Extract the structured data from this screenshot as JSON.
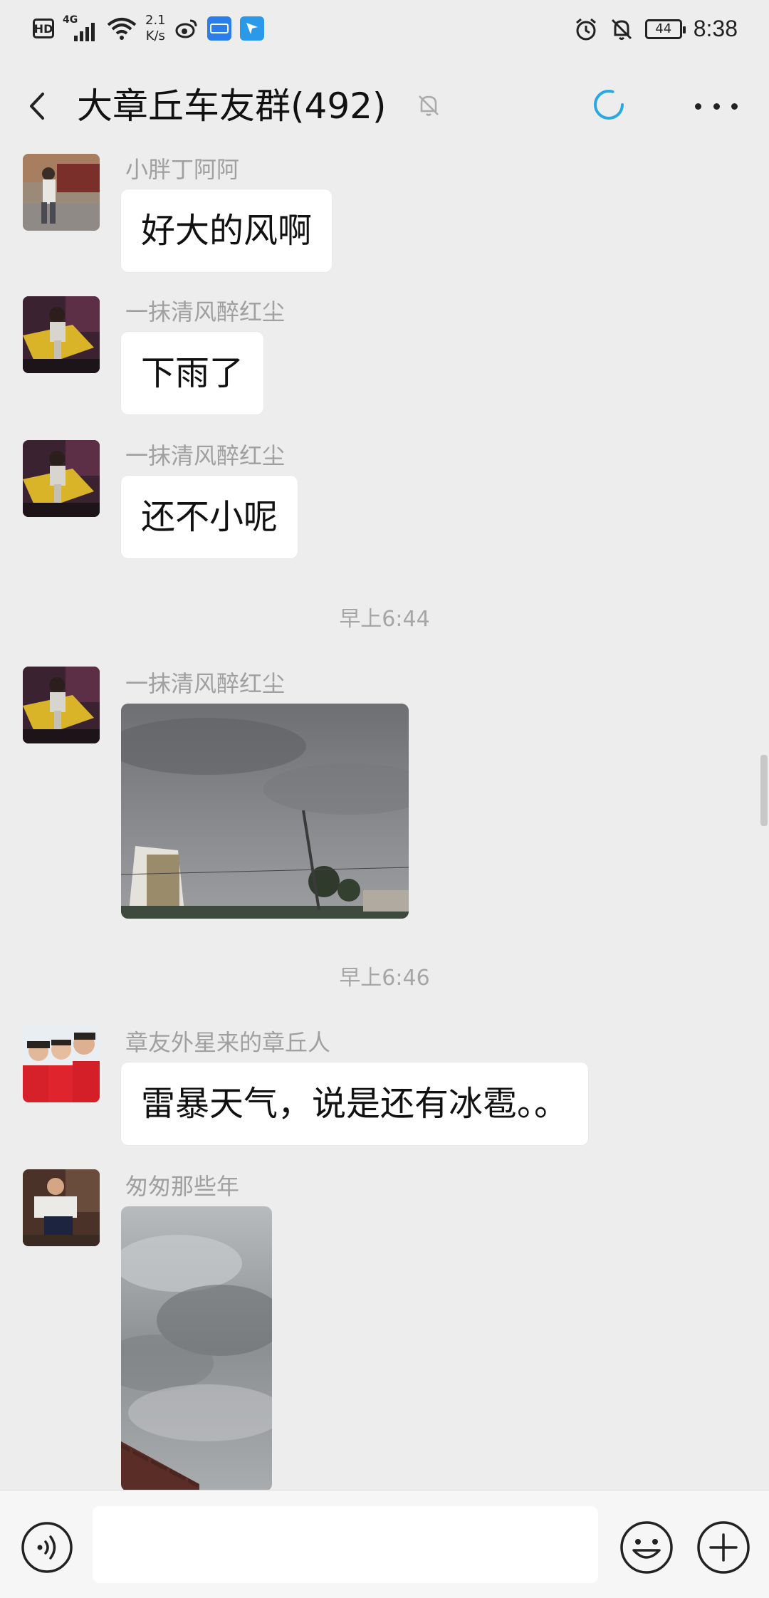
{
  "status_bar": {
    "hd_label": "HD",
    "network_label": "4G",
    "speed_value": "2.1",
    "speed_unit": "K/s",
    "battery_level": "44",
    "time": "8:38",
    "icons": [
      "hd-icon",
      "signal-icon",
      "wifi-icon",
      "weibo-icon",
      "app-icon",
      "app-icon",
      "alarm-icon",
      "bell-off-icon",
      "battery-icon"
    ]
  },
  "header": {
    "title": "大章丘车友群(492)",
    "muted": true,
    "loading": true,
    "colors": {
      "loading_accent": "#29a9e0"
    }
  },
  "messages": [
    {
      "type": "text",
      "sender": "小胖丁阿阿",
      "text": "好大的风啊"
    },
    {
      "type": "text",
      "sender": "一抹清风醉红尘",
      "text": "下雨了"
    },
    {
      "type": "text",
      "sender": "一抹清风醉红尘",
      "text": "还不小呢"
    },
    {
      "type": "time",
      "text": "早上6:44"
    },
    {
      "type": "image",
      "sender": "一抹清风醉红尘"
    },
    {
      "type": "time",
      "text": "早上6:46"
    },
    {
      "type": "text",
      "sender": "章友外星来的章丘人",
      "text": "雷暴天气，说是还有冰雹。。"
    },
    {
      "type": "image",
      "sender": "匆匆那些年"
    }
  ],
  "input_bar": {
    "placeholder": "",
    "icons": [
      "voice-icon",
      "emoji-icon",
      "plus-icon"
    ]
  }
}
